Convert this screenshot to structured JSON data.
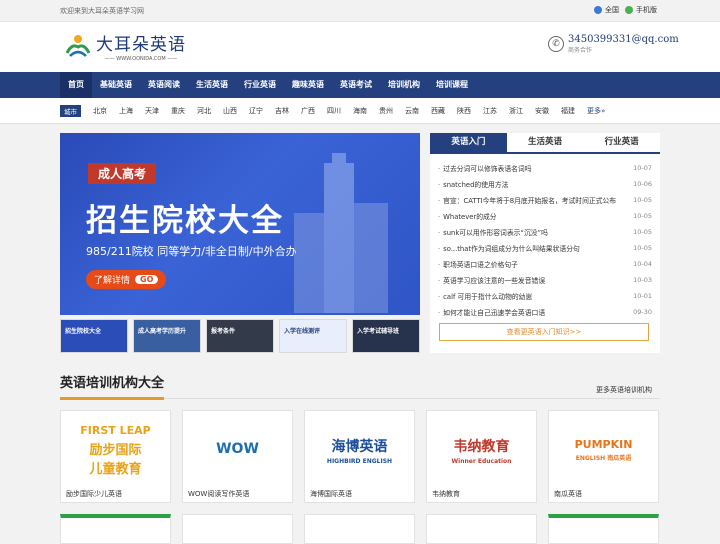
{
  "topbar": {
    "welcome": "欢迎来到大耳朵英语学习网",
    "region": "全国",
    "mobile": "手机版"
  },
  "logo": {
    "cn": "大耳朵英语",
    "en": "—— WWW.OONIDA.COM ——"
  },
  "contact": {
    "email": "3450399331@qq.com",
    "sub": "商务合作"
  },
  "nav": [
    "首页",
    "基础英语",
    "英语阅读",
    "生活英语",
    "行业英语",
    "趣味英语",
    "英语考试",
    "培训机构",
    "培训课程"
  ],
  "citybar": {
    "label": "城市",
    "cities": [
      "北京",
      "上海",
      "天津",
      "重庆",
      "河北",
      "山西",
      "辽宁",
      "吉林",
      "广西",
      "四川",
      "海南",
      "贵州",
      "云南",
      "西藏",
      "陕西",
      "江苏",
      "浙江",
      "安徽",
      "福建"
    ],
    "more": "更多»"
  },
  "banner": {
    "tag": "成人高考",
    "title": "招生院校大全",
    "subtitle": "985/211院校  同等学力/非全日制/中外合办",
    "cta": "了解详情",
    "go": "GO"
  },
  "thumbs": [
    {
      "text": "招生院校大全",
      "color": "#2b4db8"
    },
    {
      "text": "成人高考学历提升",
      "color": "#3a5fa0"
    },
    {
      "text": "报考条件",
      "color": "#333b4a"
    },
    {
      "text": "入学在线测评",
      "color": "#e8eefb"
    },
    {
      "text": "入学考试辅导班",
      "color": "#27324d"
    }
  ],
  "panel": {
    "tabs": [
      "英语入门",
      "生活英语",
      "行业英语"
    ],
    "items": [
      {
        "title": "过去分词可以修饰表语名词吗",
        "date": "10-07"
      },
      {
        "title": "snatched的使用方法",
        "date": "10-06"
      },
      {
        "title": "官宣：CATTI今年将于8月底开始报名，考试时间正式公布",
        "date": "10-05"
      },
      {
        "title": "Whatever的成分",
        "date": "10-05"
      },
      {
        "title": "sunk可以用作形容词表示“沉没”吗",
        "date": "10-05"
      },
      {
        "title": "so...that作为词组成分为什么叫结果状语分句",
        "date": "10-05"
      },
      {
        "title": "职场英语口语之价格句子",
        "date": "10-04"
      },
      {
        "title": "英语学习应该注意的一些发音错误",
        "date": "10-03"
      },
      {
        "title": "calf 可用于指什么动物的幼崽",
        "date": "10-01"
      },
      {
        "title": "如何才能让自己迅速学会英语口语",
        "date": "09-30"
      }
    ],
    "more": "查看更英语入门知识>>"
  },
  "section": {
    "title": "英语培训机构大全",
    "more": "更多英语培训机构",
    "cards": [
      {
        "name": "励步国际少儿英语",
        "logo_a": "FIRST LEAP",
        "logo_b": "励步国际\n儿童教育",
        "color": "#e8a317"
      },
      {
        "name": "WOW阅读写作英语",
        "logo_a": "WOW",
        "logo_b": "",
        "color": "#1e6fb0"
      },
      {
        "name": "海博国际英语",
        "logo_a": "海博英语",
        "logo_b": "HIGHBIRD ENGLISH",
        "color": "#1a4e9a"
      },
      {
        "name": "韦纳教育",
        "logo_a": "韦纳教育",
        "logo_b": "Winner Education",
        "color": "#c0392b"
      },
      {
        "name": "南瓜英语",
        "logo_a": "PUMPKIN",
        "logo_b": "ENGLISH 南瓜英语",
        "color": "#e8741a"
      }
    ]
  }
}
